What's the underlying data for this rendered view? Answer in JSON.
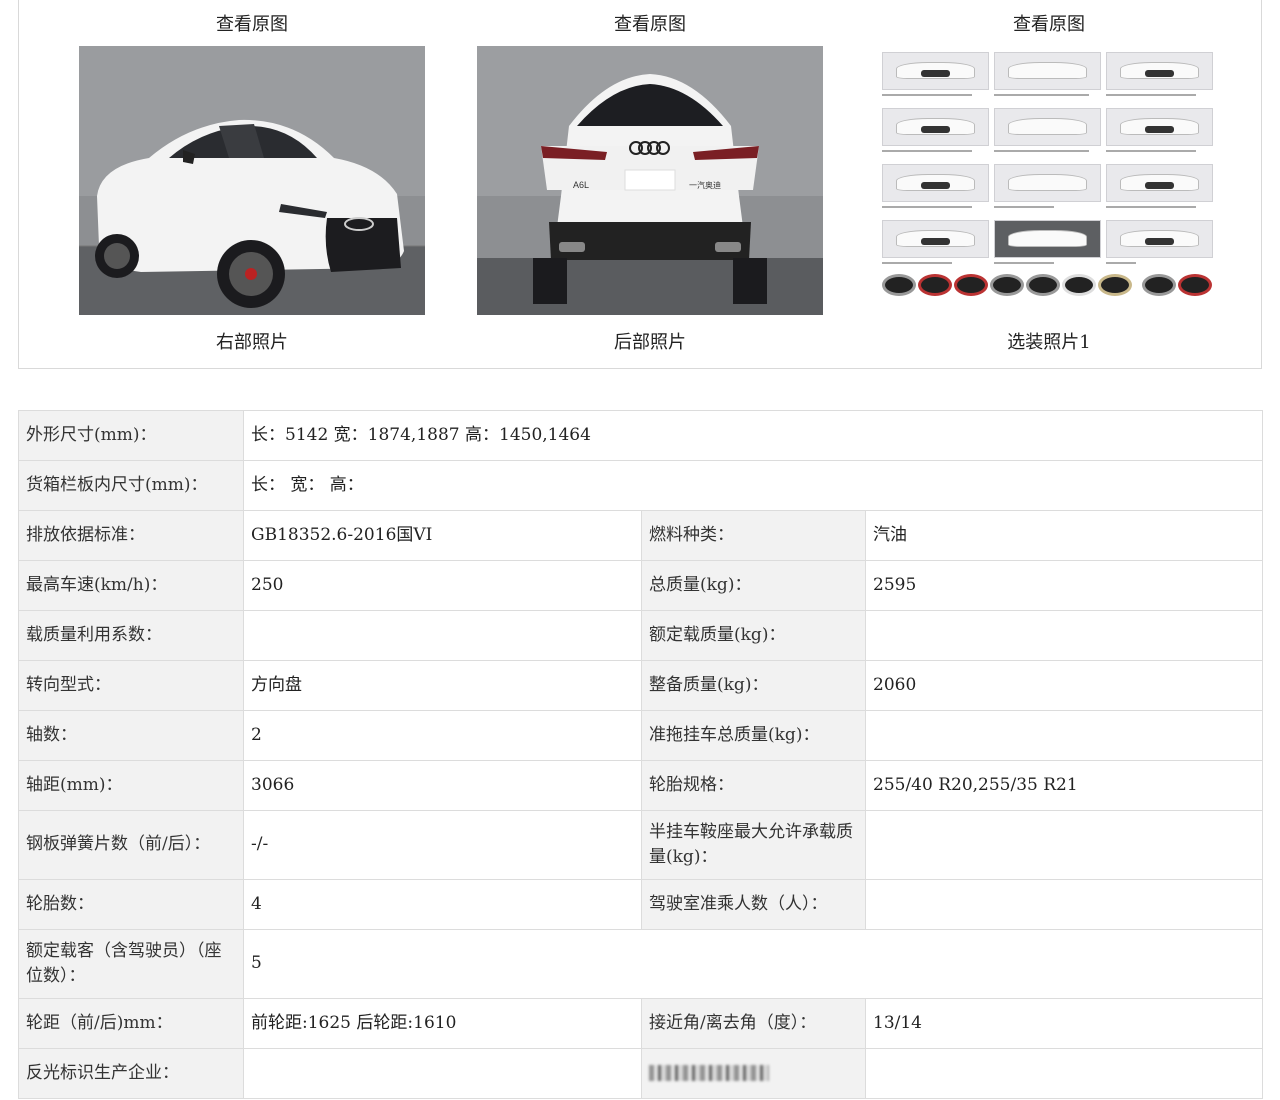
{
  "photos": [
    {
      "link": "查看原图",
      "caption": "右部照片"
    },
    {
      "link": "查看原图",
      "caption": "后部照片"
    },
    {
      "link": "查看原图",
      "caption": "选装照片1"
    }
  ],
  "rear_plate": {
    "badge": "A6L",
    "maker": "一汽奥迪"
  },
  "specs": {
    "r1": {
      "l1": "外形尺寸(mm)：",
      "v1": "长：5142 宽：1874,1887 高：1450,1464"
    },
    "r2": {
      "l1": "货箱栏板内尺寸(mm)：",
      "v1": "长：  宽：  高："
    },
    "r3": {
      "l1": "排放依据标准：",
      "v1": "GB18352.6-2016国VI",
      "l2": "燃料种类：",
      "v2": "汽油"
    },
    "r4": {
      "l1": "最高车速(km/h)：",
      "v1": "250",
      "l2": "总质量(kg)：",
      "v2": "2595"
    },
    "r5": {
      "l1": "载质量利用系数：",
      "v1": "",
      "l2": "额定载质量(kg)：",
      "v2": ""
    },
    "r6": {
      "l1": "转向型式：",
      "v1": "方向盘",
      "l2": "整备质量(kg)：",
      "v2": "2060"
    },
    "r7": {
      "l1": "轴数：",
      "v1": "2",
      "l2": "准拖挂车总质量(kg)：",
      "v2": ""
    },
    "r8": {
      "l1": "轴距(mm)：",
      "v1": "3066",
      "l2": "轮胎规格：",
      "v2": "255/40 R20,255/35 R21"
    },
    "r9": {
      "l1": "钢板弹簧片数（前/后）：",
      "v1": "-/-",
      "l2": "半挂车鞍座最大允许承载质量(kg)：",
      "v2": ""
    },
    "r10": {
      "l1": "轮胎数：",
      "v1": "4",
      "l2": "驾驶室准乘人数（人）：",
      "v2": ""
    },
    "r11": {
      "l1": "额定载客（含驾驶员）（座位数）：",
      "v1": "5"
    },
    "r12": {
      "l1": "轮距（前/后)mm：",
      "v1": "前轮距:1625 后轮距:1610",
      "l2": "接近角/离去角（度）：",
      "v2": "13/14"
    },
    "r13": {
      "l1": "反光标识生产企业：",
      "v1": "",
      "v2": ""
    }
  }
}
